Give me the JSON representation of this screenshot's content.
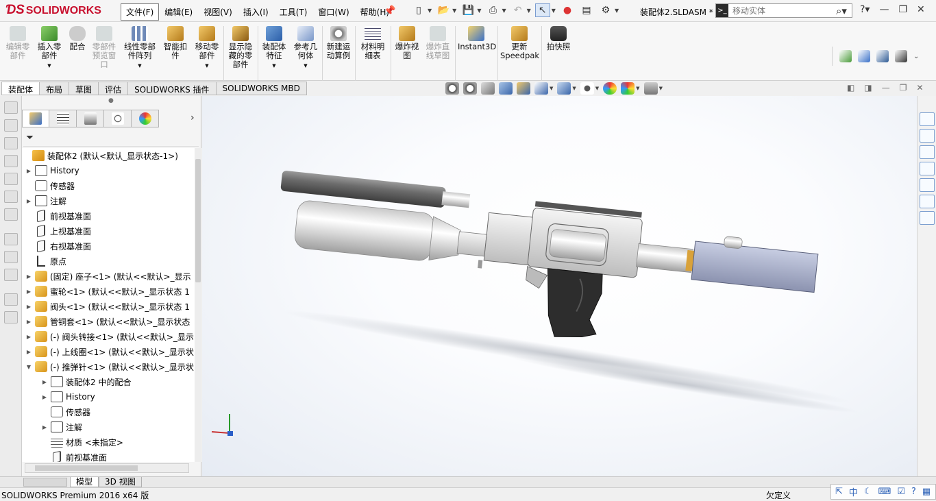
{
  "app": {
    "logo_text": "SOLIDWORKS",
    "document_title": "装配体2.SLDASM *"
  },
  "menu": {
    "items": [
      "文件(F)",
      "编辑(E)",
      "视图(V)",
      "插入(I)",
      "工具(T)",
      "窗口(W)",
      "帮助(H)"
    ]
  },
  "search": {
    "placeholder": "移动实体"
  },
  "command_manager": {
    "items": [
      {
        "label": "编辑零\n部件",
        "enabled": false
      },
      {
        "label": "插入零\n部件",
        "enabled": true
      },
      {
        "label": "配合",
        "enabled": true
      },
      {
        "label": "零部件\n预览窗\n口",
        "enabled": false
      },
      {
        "label": "线性零部\n件阵列",
        "enabled": true
      },
      {
        "label": "智能扣\n件",
        "enabled": true
      },
      {
        "label": "移动零\n部件",
        "enabled": true
      },
      {
        "label": "显示隐\n藏的零\n部件",
        "enabled": true
      },
      {
        "label": "装配体\n特征",
        "enabled": true
      },
      {
        "label": "参考几\n何体",
        "enabled": true
      },
      {
        "label": "新建运\n动算例",
        "enabled": true
      },
      {
        "label": "材料明\n细表",
        "enabled": true
      },
      {
        "label": "爆炸视\n图",
        "enabled": true
      },
      {
        "label": "爆炸直\n线草图",
        "enabled": false
      },
      {
        "label": "Instant3D",
        "enabled": true
      },
      {
        "label": "更新\nSpeedpak",
        "enabled": true
      },
      {
        "label": "拍快照",
        "enabled": true
      }
    ]
  },
  "tabs": [
    "装配体",
    "布局",
    "草图",
    "评估",
    "SOLIDWORKS 插件",
    "SOLIDWORKS MBD"
  ],
  "feature_tree": {
    "root": "装配体2  (默认<默认_显示状态-1>)",
    "rows": [
      {
        "label": "History",
        "icon": "history-icon",
        "depth": 1,
        "expander": "▶"
      },
      {
        "label": "传感器",
        "icon": "sensor-icon",
        "depth": 1,
        "expander": ""
      },
      {
        "label": "注解",
        "icon": "annotation-icon",
        "depth": 1,
        "expander": "▶"
      },
      {
        "label": "前视基准面",
        "icon": "plane-icon",
        "depth": 1,
        "expander": ""
      },
      {
        "label": "上视基准面",
        "icon": "plane-icon",
        "depth": 1,
        "expander": ""
      },
      {
        "label": "右视基准面",
        "icon": "plane-icon",
        "depth": 1,
        "expander": ""
      },
      {
        "label": "原点",
        "icon": "origin-icon",
        "depth": 1,
        "expander": ""
      },
      {
        "label": "(固定) 座子<1> (默认<<默认>_显示",
        "icon": "part-icon",
        "depth": 1,
        "expander": "▶"
      },
      {
        "label": "蜜轮<1> (默认<<默认>_显示状态 1",
        "icon": "part-icon",
        "depth": 1,
        "expander": "▶"
      },
      {
        "label": "阀头<1> (默认<<默认>_显示状态 1",
        "icon": "part-icon",
        "depth": 1,
        "expander": "▶"
      },
      {
        "label": "管铜套<1> (默认<<默认>_显示状态",
        "icon": "part-icon",
        "depth": 1,
        "expander": "▶"
      },
      {
        "label": "(-) 阀头转接<1> (默认<<默认>_显示",
        "icon": "part-icon",
        "depth": 1,
        "expander": "▶"
      },
      {
        "label": "(-) 上线圈<1> (默认<<默认>_显示状",
        "icon": "part-icon",
        "depth": 1,
        "expander": "▶"
      },
      {
        "label": "(-) 推弹针<1> (默认<<默认>_显示状",
        "icon": "part-icon",
        "depth": 1,
        "expander": "▼"
      },
      {
        "label": "装配体2 中的配合",
        "icon": "mates-icon",
        "depth": 2,
        "expander": "▶"
      },
      {
        "label": "History",
        "icon": "history-icon",
        "depth": 2,
        "expander": "▶"
      },
      {
        "label": "传感器",
        "icon": "sensor-icon",
        "depth": 2,
        "expander": ""
      },
      {
        "label": "注解",
        "icon": "annotation-icon",
        "depth": 2,
        "expander": "▶"
      },
      {
        "label": "材质 <未指定>",
        "icon": "material-icon",
        "depth": 2,
        "expander": ""
      },
      {
        "label": "前视基准面",
        "icon": "plane-icon",
        "depth": 2,
        "expander": ""
      }
    ]
  },
  "bottom_tabs": [
    "模型",
    "3D 视图"
  ],
  "status": {
    "left": "SOLIDWORKS Premium 2016 x64 版",
    "right": "欠定义"
  },
  "tray": {
    "ime": "中"
  },
  "colors": {
    "brand_red": "#c8102e",
    "accent_blue": "#2a6bd1",
    "gun_grip": "#2d2d2d",
    "gun_body": "#d9d9d9"
  }
}
